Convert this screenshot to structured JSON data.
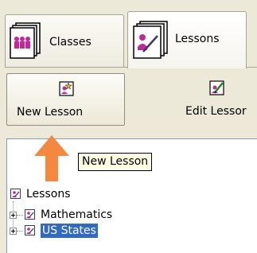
{
  "tabs": [
    {
      "label": "Classes",
      "icon": "classes-icon"
    },
    {
      "label": "Lessons",
      "icon": "lessons-icon",
      "active": true
    }
  ],
  "toolbar": {
    "new_lesson_label": "New Lesson",
    "edit_lesson_label": "Edit Lessor"
  },
  "tooltip": "New Lesson",
  "tree": {
    "root": "Lessons",
    "children": [
      {
        "label": "Mathematics",
        "selected": false
      },
      {
        "label": "US States",
        "selected": true
      }
    ]
  },
  "colors": {
    "selection": "#316ac5",
    "arrow": "#f4883f",
    "tooltip_bg": "#ffffe1",
    "panel_bg": "#ece9d8",
    "icon_magenta": "#c4249c"
  }
}
